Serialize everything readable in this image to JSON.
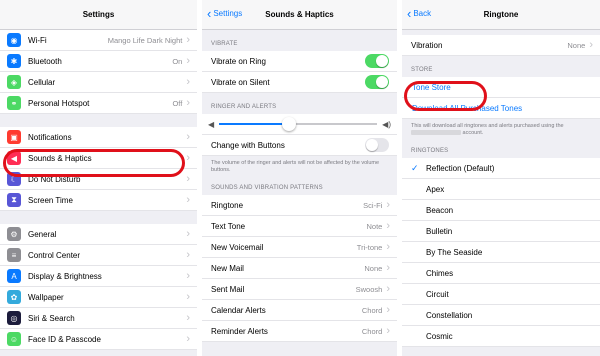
{
  "settings": {
    "title": "Settings",
    "group1": [
      {
        "icon": "wifi-icon",
        "glyph": "◉",
        "color": "#0a7aff",
        "label": "Wi-Fi",
        "value": "Mango Life Dark Night"
      },
      {
        "icon": "bluetooth-icon",
        "glyph": "✱",
        "color": "#0a7aff",
        "label": "Bluetooth",
        "value": "On"
      },
      {
        "icon": "cellular-icon",
        "glyph": "◈",
        "color": "#4cd964",
        "label": "Cellular",
        "value": ""
      },
      {
        "icon": "hotspot-icon",
        "glyph": "⚭",
        "color": "#4cd964",
        "label": "Personal Hotspot",
        "value": "Off"
      }
    ],
    "group2": [
      {
        "icon": "notifications-icon",
        "glyph": "▣",
        "color": "#ff3b30",
        "label": "Notifications"
      },
      {
        "icon": "sounds-icon",
        "glyph": "◀",
        "color": "#ff2d55",
        "label": "Sounds & Haptics"
      },
      {
        "icon": "moon-icon",
        "glyph": "☾",
        "color": "#5856d6",
        "label": "Do Not Disturb"
      },
      {
        "icon": "hourglass-icon",
        "glyph": "⧗",
        "color": "#5856d6",
        "label": "Screen Time"
      }
    ],
    "group3": [
      {
        "icon": "gear-icon",
        "glyph": "⚙",
        "color": "#8e8e93",
        "label": "General"
      },
      {
        "icon": "control-center-icon",
        "glyph": "≡",
        "color": "#8e8e93",
        "label": "Control Center"
      },
      {
        "icon": "brightness-icon",
        "glyph": "A",
        "color": "#0a7aff",
        "label": "Display & Brightness"
      },
      {
        "icon": "wallpaper-icon",
        "glyph": "✿",
        "color": "#34aadc",
        "label": "Wallpaper"
      },
      {
        "icon": "siri-icon",
        "glyph": "◎",
        "color": "#1c1c3c",
        "label": "Siri & Search"
      },
      {
        "icon": "faceid-icon",
        "glyph": "☺",
        "color": "#4cd964",
        "label": "Face ID & Passcode"
      }
    ]
  },
  "sounds": {
    "back": "Settings",
    "title": "Sounds & Haptics",
    "vibrate_header": "VIBRATE",
    "vibrate_on_ring": "Vibrate on Ring",
    "vibrate_on_silent": "Vibrate on Silent",
    "ringer_header": "RINGER AND ALERTS",
    "volume_level": 0.44,
    "change_with_buttons": "Change with Buttons",
    "note": "The volume of the ringer and alerts will not be affected by the volume buttons.",
    "patterns_header": "SOUNDS AND VIBRATION PATTERNS",
    "patterns": [
      {
        "label": "Ringtone",
        "value": "Sci-Fi"
      },
      {
        "label": "Text Tone",
        "value": "Note"
      },
      {
        "label": "New Voicemail",
        "value": "Tri-tone"
      },
      {
        "label": "New Mail",
        "value": "None"
      },
      {
        "label": "Sent Mail",
        "value": "Swoosh"
      },
      {
        "label": "Calendar Alerts",
        "value": "Chord"
      },
      {
        "label": "Reminder Alerts",
        "value": "Chord"
      }
    ]
  },
  "ringtone": {
    "back": "Back",
    "title": "Ringtone",
    "vibration_label": "Vibration",
    "vibration_value": "None",
    "store_header": "STORE",
    "tone_store": "Tone Store",
    "download_all": "Download All Purchased Tones",
    "note_prefix": "This will download all ringtones and alerts purchased using the",
    "note_suffix": "account.",
    "ringtones_header": "RINGTONES",
    "tones": [
      "Reflection (Default)",
      "Apex",
      "Beacon",
      "Bulletin",
      "By The Seaside",
      "Chimes",
      "Circuit",
      "Constellation",
      "Cosmic"
    ]
  },
  "colors": {
    "accent": "#0a7aff",
    "highlight": "#e0101a",
    "toggle_on": "#4cd964"
  }
}
